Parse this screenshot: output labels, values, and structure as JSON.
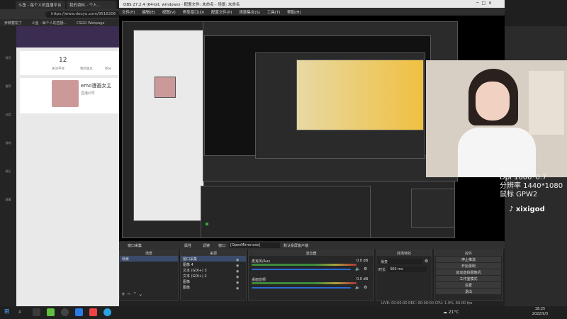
{
  "browser": {
    "tabs": [
      "斗鱼 - 每个人的直播平台",
      "我的资料 - 个人..."
    ],
    "address": "https://www.douyu.com/9516206",
    "bookmarks": [
      "养精蓄锐了",
      "斗鱼 - 每个人的直播...",
      "CSGO Webpage"
    ],
    "rail": [
      "首页",
      "推荐",
      "分类",
      "游戏",
      "娱乐",
      "赛事"
    ]
  },
  "site": {
    "stats": [
      {
        "num": "12",
        "label": "关注平台"
      },
      {
        "num": "",
        "label": "我的鱼丸"
      },
      {
        "num": "",
        "label": "积分"
      }
    ],
    "streamer_name": "emo漫画女主",
    "streamer_sub": "直播间号"
  },
  "obs": {
    "title": "OBS 27.2.4 (64-bit, windows) - 配置文件: 未命名 - 场景: 未命名",
    "menu": [
      "文件(F)",
      "编辑(E)",
      "视图(V)",
      "停靠窗口(D)",
      "配置文件(P)",
      "场景集合(S)",
      "工具(T)",
      "帮助(H)"
    ],
    "source_bar": [
      "窗口采集",
      "属性",
      "滤镜",
      "窗口",
      "[OpenMirror.exe]",
      "默认投屏客户端"
    ],
    "docks": {
      "scenes": {
        "title": "场景",
        "items": [
          "场景"
        ]
      },
      "sources": {
        "title": "来源",
        "items": [
          "窗口采集",
          "图像 4",
          "文本 (GDI+) 3",
          "文本 (GDI+) 2",
          "图像",
          "图像"
        ]
      },
      "mixer": {
        "title": "混音器",
        "channels": [
          {
            "name": "麦克风/Aux",
            "db": "0.0 dB"
          },
          {
            "name": "桌面音频",
            "db": "0.0 dB"
          }
        ]
      },
      "transitions": {
        "title": "转场特效",
        "mode": "渐变",
        "duration_label": "时长",
        "duration": "300 ms"
      },
      "controls": {
        "title": "控件",
        "buttons": [
          "停止推流",
          "开始录制",
          "启动虚拟摄像机",
          "工作室模式",
          "设置",
          "退出"
        ]
      }
    },
    "status": "LIVE: 00:00:00  REC: 00:00:00  CPU: 1.9%, 60.00 fps"
  },
  "cam": {
    "lines": [
      "Dpi 1600*0.7",
      "分辨率 1440*1080",
      "鼠标 GPW2"
    ],
    "brand": "xixigod"
  },
  "taskbar": {
    "weather": "21°C",
    "time": "18:25",
    "date": "2022/9/3"
  }
}
